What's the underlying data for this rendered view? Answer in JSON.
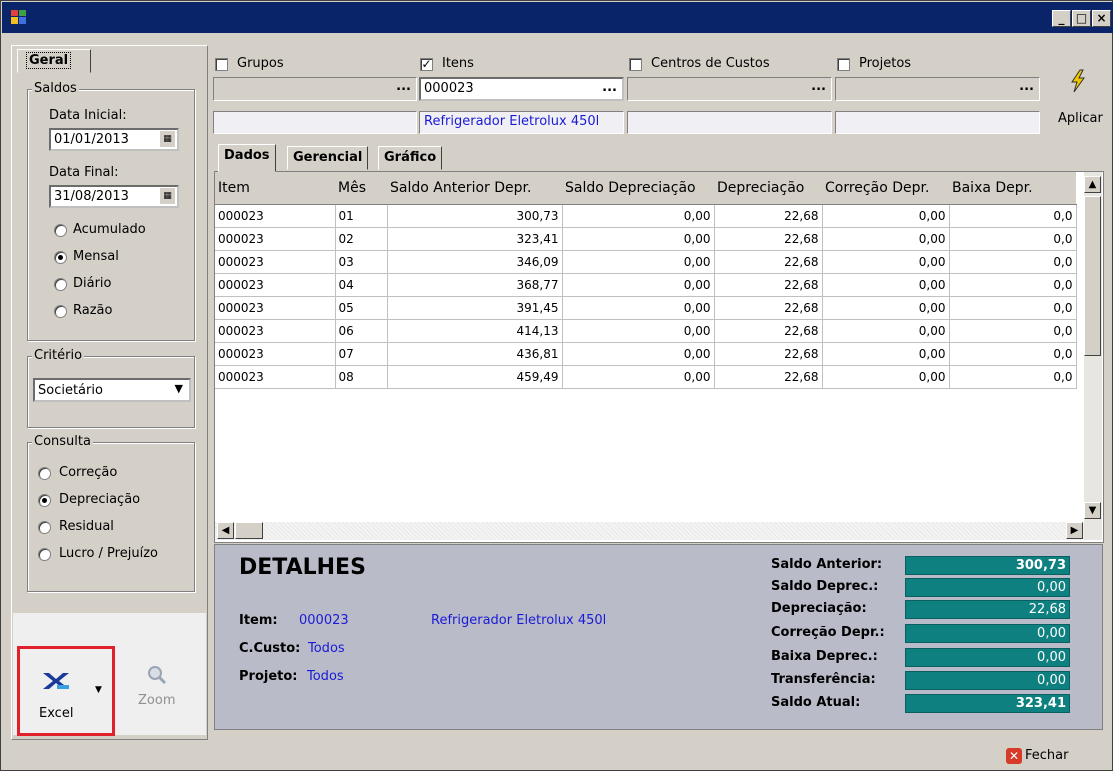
{
  "window": {
    "min_glyph": "_",
    "max_glyph": "□",
    "close_glyph": "×"
  },
  "left": {
    "tab": "Geral",
    "saldos": {
      "title": "Saldos",
      "data_inicial_label": "Data Inicial:",
      "data_inicial": "01/01/2013",
      "data_final_label": "Data Final:",
      "data_final": "31/08/2013",
      "options": [
        "Acumulado",
        "Mensal",
        "Diário",
        "Razão"
      ],
      "selected": "Mensal"
    },
    "criterio": {
      "title": "Critério",
      "value": "Societário"
    },
    "consulta": {
      "title": "Consulta",
      "options": [
        "Correção",
        "Depreciação",
        "Residual",
        "Lucro / Prejuízo"
      ],
      "selected": "Depreciação"
    },
    "excel_label": "Excel",
    "zoom_label": "Zoom"
  },
  "filters": {
    "grupos": {
      "label": "Grupos",
      "checked": false,
      "value": "",
      "desc": ""
    },
    "itens": {
      "label": "Itens",
      "checked": true,
      "value": "000023",
      "desc": "Refrigerador Eletrolux 450l"
    },
    "centros": {
      "label": "Centros de Custos",
      "checked": false,
      "value": "",
      "desc": ""
    },
    "projetos": {
      "label": "Projetos",
      "checked": false,
      "value": "",
      "desc": ""
    },
    "ellipsis": "...",
    "aplicar_label": "Aplicar"
  },
  "tabs": [
    "Dados",
    "Gerencial",
    "Gráfico"
  ],
  "grid": {
    "columns": [
      "Item",
      "Mês",
      "Saldo Anterior Depr.",
      "Saldo Depreciação",
      "Depreciação",
      "Correção Depr.",
      "Baixa Depr."
    ],
    "rows": [
      [
        "000023",
        "01",
        "300,73",
        "0,00",
        "22,68",
        "0,00",
        "0,0"
      ],
      [
        "000023",
        "02",
        "323,41",
        "0,00",
        "22,68",
        "0,00",
        "0,0"
      ],
      [
        "000023",
        "03",
        "346,09",
        "0,00",
        "22,68",
        "0,00",
        "0,0"
      ],
      [
        "000023",
        "04",
        "368,77",
        "0,00",
        "22,68",
        "0,00",
        "0,0"
      ],
      [
        "000023",
        "05",
        "391,45",
        "0,00",
        "22,68",
        "0,00",
        "0,0"
      ],
      [
        "000023",
        "06",
        "414,13",
        "0,00",
        "22,68",
        "0,00",
        "0,0"
      ],
      [
        "000023",
        "07",
        "436,81",
        "0,00",
        "22,68",
        "0,00",
        "0,0"
      ],
      [
        "000023",
        "08",
        "459,49",
        "0,00",
        "22,68",
        "0,00",
        "0,0"
      ]
    ]
  },
  "details": {
    "title": "DETALHES",
    "item_label": "Item:",
    "item_code": "000023",
    "item_desc": "Refrigerador Eletrolux 450l",
    "ccusto_label": "C.Custo:",
    "ccusto_value": "Todos",
    "projeto_label": "Projeto:",
    "projeto_value": "Todos",
    "saldos": [
      {
        "label": "Saldo Anterior:",
        "value": "300,73"
      },
      {
        "label": "Saldo Deprec.:",
        "value": "0,00"
      },
      {
        "label": "Depreciação:",
        "value": "22,68"
      },
      {
        "label": "Correção Depr.:",
        "value": "0,00"
      },
      {
        "label": "Baixa Deprec.:",
        "value": "0,00"
      },
      {
        "label": "Transferência:",
        "value": "0,00"
      },
      {
        "label": "Saldo Atual:",
        "value": "323,41"
      }
    ]
  },
  "footer": {
    "fechar_label": "Fechar"
  },
  "colors": {
    "title_bar": "#0a246a",
    "saldo_box": "#0f8080",
    "details_bg": "#b9bcc8",
    "highlight_box": "#e0202a",
    "link_blue": "#1a1ad6"
  }
}
